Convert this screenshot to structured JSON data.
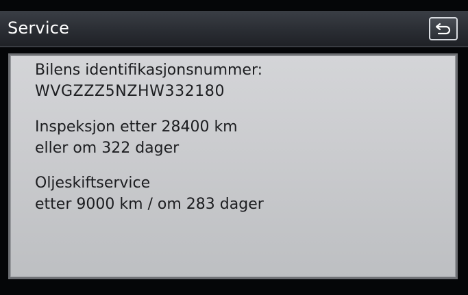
{
  "header": {
    "title": "Service",
    "back_icon": "back-arrow-icon"
  },
  "service_info": {
    "vin_label": "Bilens identifikasjonsnummer:",
    "vin_value": "WVGZZZ5NZHW332180",
    "inspection_line1": "Inspeksjon etter 28400 km",
    "inspection_line2": "eller om 322 dager",
    "oil_line1": "Oljeskiftservice",
    "oil_line2": "etter 9000 km / om 283 dager"
  },
  "colors": {
    "title_bar": "#2a2d33",
    "panel_background": "#c9cacd",
    "text": "#1c1d20",
    "title_text": "#ffffff"
  }
}
